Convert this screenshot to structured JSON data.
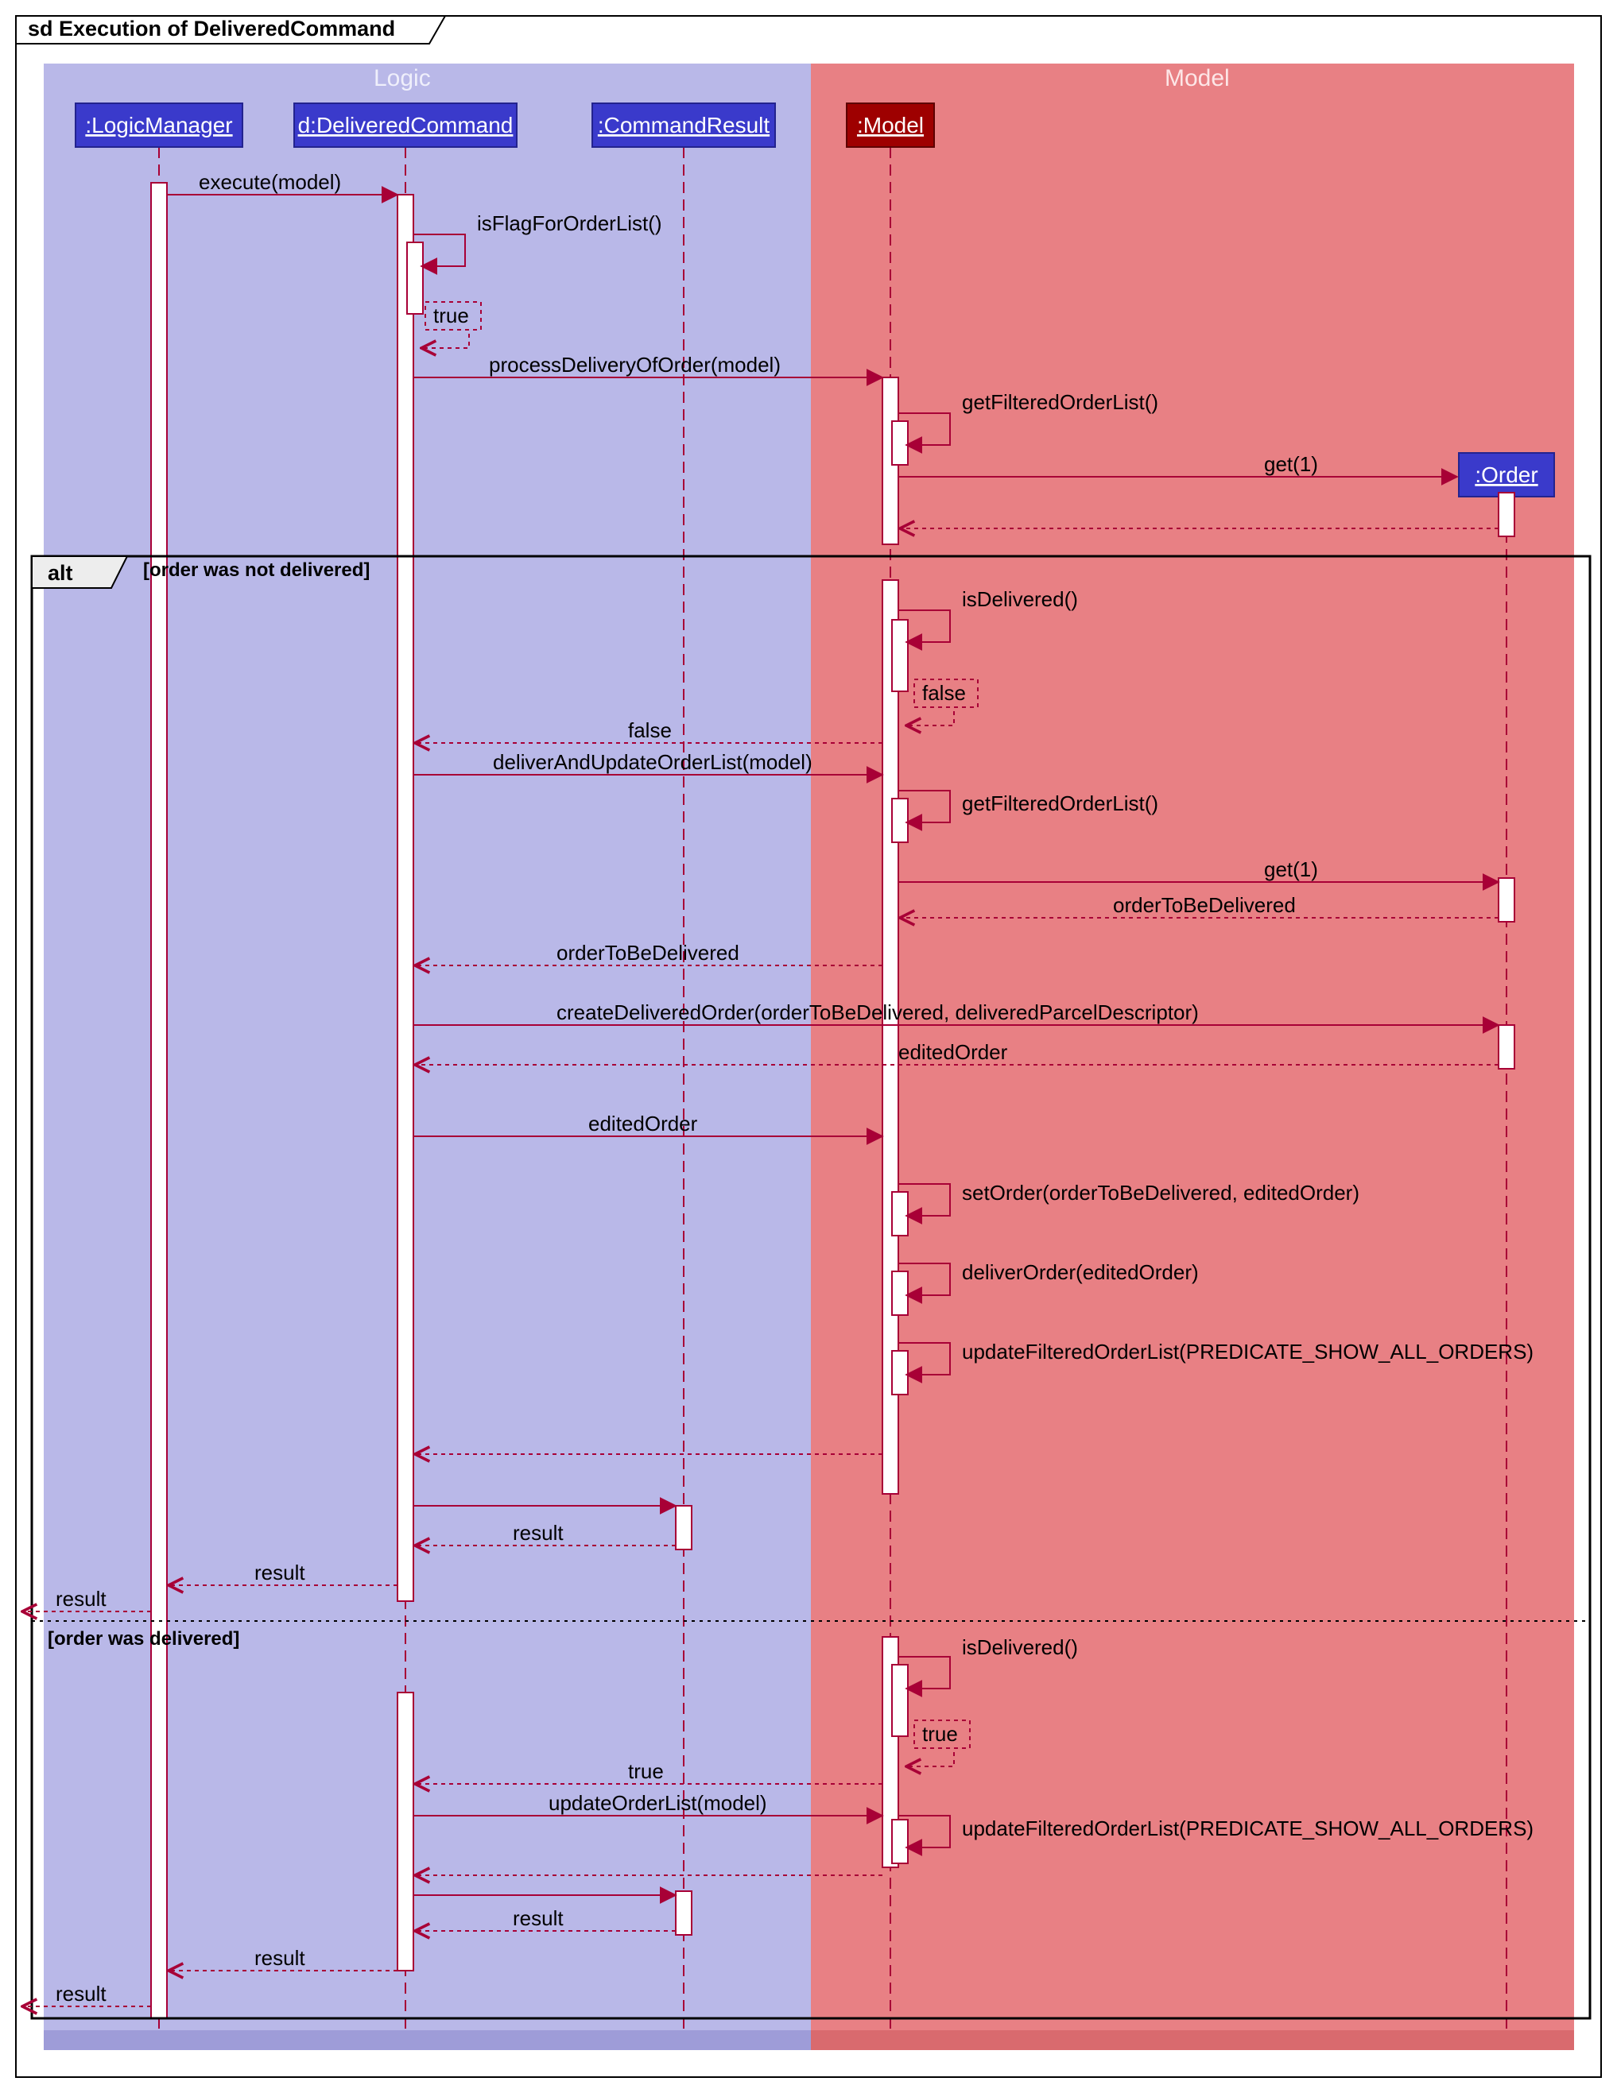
{
  "frame": {
    "title": "sd Execution of DeliveredCommand"
  },
  "regions": {
    "logic": {
      "label": "Logic"
    },
    "model": {
      "label": "Model"
    }
  },
  "participants": {
    "logicManager": {
      "label": ":LogicManager"
    },
    "deliveredCommand": {
      "label": "d:DeliveredCommand"
    },
    "commandResult": {
      "label": ":CommandResult"
    },
    "model": {
      "label": ":Model"
    },
    "order": {
      "label": ":Order"
    }
  },
  "alt": {
    "label": "alt",
    "guard1": "[order was not delivered]",
    "guard2": "[order was delivered]"
  },
  "messages": {
    "m01": "execute(model)",
    "m02": "isFlagForOrderList()",
    "m03": "true",
    "m04": "processDeliveryOfOrder(model)",
    "m05": "getFilteredOrderList()",
    "m06": "get(1)",
    "m07": "isDelivered()",
    "m08": "false",
    "m09": "false",
    "m10": "deliverAndUpdateOrderList(model)",
    "m11": "getFilteredOrderList()",
    "m12": "get(1)",
    "m13": "orderToBeDelivered",
    "m14": "orderToBeDelivered",
    "m15": "createDeliveredOrder(orderToBeDelivered, deliveredParcelDescriptor)",
    "m16": "editedOrder",
    "m17": "editedOrder",
    "m18": "setOrder(orderToBeDelivered, editedOrder)",
    "m19": "deliverOrder(editedOrder)",
    "m20": "updateFilteredOrderList(PREDICATE_SHOW_ALL_ORDERS)",
    "m21": "result",
    "m22": "result",
    "m23": "result",
    "m24": "isDelivered()",
    "m25": "true",
    "m26": "true",
    "m27": "updateOrderList(model)",
    "m28": "updateFilteredOrderList(PREDICATE_SHOW_ALL_ORDERS)",
    "m29": "result",
    "m30": "result",
    "m31": "result"
  }
}
